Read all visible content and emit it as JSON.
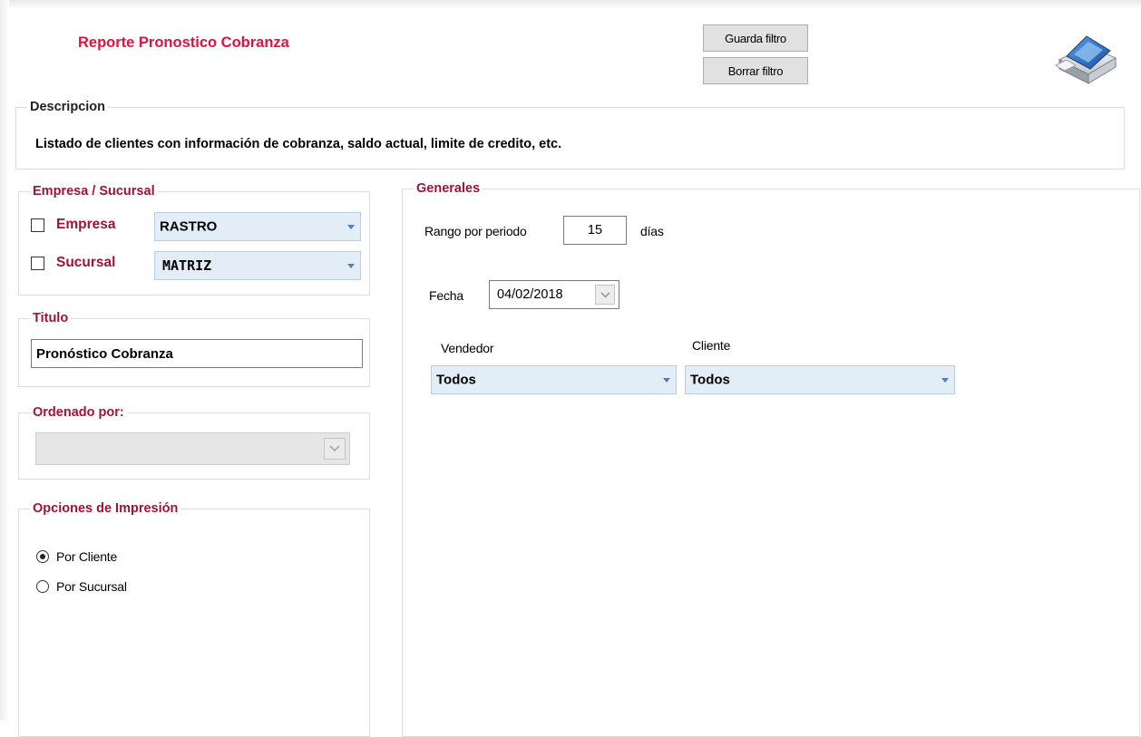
{
  "report": {
    "title": "Reporte Pronostico Cobranza"
  },
  "toolbar": {
    "save_filter": "Guarda filtro",
    "clear_filter": "Borrar filtro"
  },
  "descripcion": {
    "legend": "Descripcion",
    "text": "Listado de clientes con información de cobranza, saldo actual, limite de credito, etc."
  },
  "empresa_sucursal": {
    "legend": "Empresa / Sucursal",
    "empresa": {
      "label": "Empresa",
      "checked": false,
      "value": "RASTRO"
    },
    "sucursal": {
      "label": "Sucursal",
      "checked": false,
      "value": "MATRIZ"
    }
  },
  "titulo": {
    "legend": "Titulo",
    "value": "Pronóstico Cobranza"
  },
  "ordenado": {
    "legend": "Ordenado por:",
    "value": ""
  },
  "opciones": {
    "legend": "Opciones de Impresión",
    "options": [
      {
        "label": "Por Cliente",
        "selected": true
      },
      {
        "label": "Por Sucursal",
        "selected": false
      }
    ]
  },
  "generales": {
    "legend": "Generales",
    "rango_label": "Rango por periodo",
    "rango_value": "15",
    "rango_unit": "días",
    "fecha_label": "Fecha",
    "fecha_value": "04/02/2018",
    "vendedor_label": "Vendedor",
    "vendedor_value": "Todos",
    "cliente_label": "Cliente",
    "cliente_value": "Todos"
  },
  "icons": {
    "printer": "printer-icon",
    "dropdown": "chevron-down-icon"
  },
  "colors": {
    "title": "#e0123f",
    "legend_red": "#a0123a",
    "combo_bg": "#e3edf8",
    "combo_arrow": "#4a7fc1"
  }
}
